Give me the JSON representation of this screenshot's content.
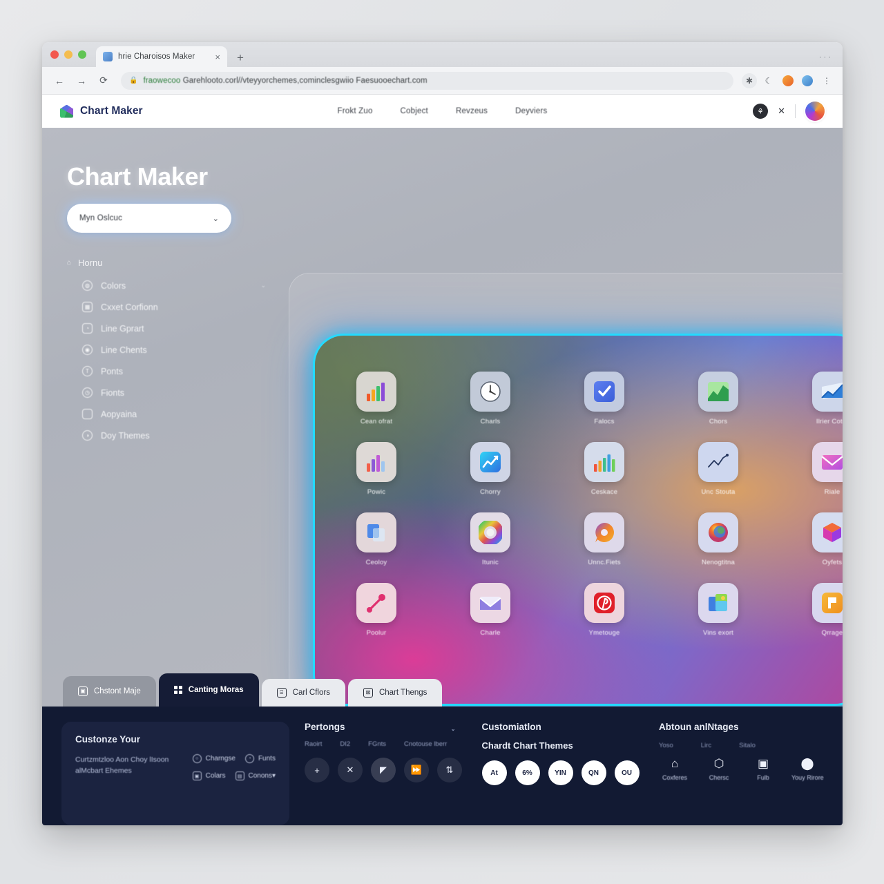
{
  "browser": {
    "tab_title": "hrie Charoisos Maker",
    "tab_close": "×",
    "new_tab": "+",
    "window_controls": "···",
    "back": "←",
    "forward": "→",
    "reload": "⟳",
    "lock_icon": "lock-icon",
    "url_secure_part": "fraowecoo",
    "url_rest": "Garehlooto.corl//vteyyorchemes,cominclesgwiio Faesuooechart.com",
    "star_icon": "★",
    "toolbar_icons": [
      "star-icon",
      "crescent-icon",
      "extension-orange-icon",
      "extension-blue-icon",
      "kebab-menu-icon"
    ]
  },
  "header": {
    "brand": "Chart Maker",
    "nav": [
      "Frokt Zuo",
      "Cobject",
      "Revzeus",
      "Deyviers"
    ],
    "dark_badge": "⚘",
    "action_icon": "✕",
    "avatar": "user-avatar"
  },
  "sidebar": {
    "title": "Chart Maker",
    "select_value": "Myn Oslcuc",
    "select_caret": "⌄",
    "menu_head": {
      "glyph": "⌂",
      "label": "Hornu"
    },
    "items": [
      {
        "label": "Colors",
        "icon": "palette-icon",
        "glyph": "◍",
        "shape": "round",
        "caret": "⌄"
      },
      {
        "label": "Cxxet Corfionn",
        "icon": "bar-chart-icon",
        "glyph": "▦",
        "shape": "square",
        "caret": ""
      },
      {
        "label": "Line Gprart",
        "icon": "line-chart-icon",
        "glyph": "◔",
        "shape": "square",
        "caret": ""
      },
      {
        "label": "Line Chents",
        "icon": "chart-icon",
        "glyph": "◉",
        "shape": "round",
        "caret": ""
      },
      {
        "label": "Ponts",
        "icon": "font-icon",
        "glyph": "T",
        "shape": "round",
        "caret": ""
      },
      {
        "label": "Fionts",
        "icon": "clock-icon",
        "glyph": "◷",
        "shape": "round",
        "caret": ""
      },
      {
        "label": "Aopyaina",
        "icon": "window-icon",
        "glyph": "",
        "shape": "plain",
        "caret": ""
      },
      {
        "label": "Doy Themes",
        "icon": "theme-icon",
        "glyph": "◑",
        "shape": "round",
        "caret": ""
      }
    ]
  },
  "showcase": {
    "tiles": [
      {
        "label": "Cean ofrat",
        "icon": "bar-chart-icon",
        "tile_bg": "#d8d6d0",
        "kind": "bars-rainbow"
      },
      {
        "label": "Charls",
        "icon": "clock-icon",
        "tile_bg": "#c2cad8",
        "kind": "clock"
      },
      {
        "label": "Falocs",
        "icon": "checkmark-icon",
        "tile_bg": "#c2cbe0",
        "kind": "check"
      },
      {
        "label": "Chors",
        "icon": "area-chart-icon",
        "tile_bg": "#c6cfe0",
        "kind": "area-green"
      },
      {
        "label": "Ilrier Cotot",
        "icon": "trend-chart-icon",
        "tile_bg": "#cdd6ea",
        "kind": "trend-blue"
      },
      {
        "label": "Powic",
        "icon": "bar-chart-icon",
        "tile_bg": "#ded9d6",
        "kind": "bars-pastel"
      },
      {
        "label": "Chorry",
        "icon": "line-chart-app-icon",
        "tile_bg": "#cfd5e6",
        "kind": "line-app"
      },
      {
        "label": "Ceskace",
        "icon": "bar-chart-icon",
        "tile_bg": "#d5dceb",
        "kind": "bars-multi"
      },
      {
        "label": "Unc Stouta",
        "icon": "zigzag-line-icon",
        "tile_bg": "#ced7ef",
        "kind": "zigzag"
      },
      {
        "label": "Riale",
        "icon": "mail-icon",
        "tile_bg": "#e6d7ea",
        "kind": "mail-pink"
      },
      {
        "label": "Ceoloy",
        "icon": "files-icon",
        "tile_bg": "#e3d7da",
        "kind": "files"
      },
      {
        "label": "Itunic",
        "icon": "color-wheel-icon",
        "tile_bg": "#e2dbe6",
        "kind": "colorwheel"
      },
      {
        "label": "Unnc.Fiets",
        "icon": "chat-bubble-icon",
        "tile_bg": "#ded9ea",
        "kind": "bubble-orange"
      },
      {
        "label": "Nenogtitna",
        "icon": "firefox-icon",
        "tile_bg": "#d6daef",
        "kind": "firefox"
      },
      {
        "label": "Oyfets",
        "icon": "cube-icon",
        "tile_bg": "#d5dcf0",
        "kind": "cube"
      },
      {
        "label": "Poolur",
        "icon": "pin-icon",
        "tile_bg": "#f0d5dd",
        "kind": "pin"
      },
      {
        "label": "Charle",
        "icon": "mail-icon",
        "tile_bg": "#ecd8e4",
        "kind": "mail-violet"
      },
      {
        "label": "Ymetouge",
        "icon": "pinterest-icon",
        "tile_bg": "#eed5dd",
        "kind": "pinterest"
      },
      {
        "label": "Vins exort",
        "icon": "photos-icon",
        "tile_bg": "#dcd8ee",
        "kind": "photos"
      },
      {
        "label": "Qrrage",
        "icon": "note-icon",
        "tile_bg": "#d8d8ef",
        "kind": "note-amber"
      }
    ]
  },
  "bottom_tabs": [
    {
      "label": "Chstont Maje",
      "icon": "image-icon",
      "state": "inactive-grey"
    },
    {
      "label": "Canting Moras",
      "icon": "grid-icon",
      "state": "active"
    },
    {
      "label": "Carl Cflors",
      "icon": "bag-icon",
      "state": "light"
    },
    {
      "label": "Chart Thengs",
      "icon": "chart-icon",
      "state": "light"
    }
  ],
  "footer": {
    "card": {
      "title": "Custonze Your",
      "text": "Curtzmtzloo  Aon Choy lIsoon alMcbart Ehemes",
      "links": [
        {
          "label": "Charngse",
          "icon": "circle-icon",
          "shape": "round",
          "glyph": "○"
        },
        {
          "label": "Funts",
          "icon": "font-icon",
          "shape": "round",
          "glyph": "◔"
        },
        {
          "label": "Colars",
          "icon": "image-icon",
          "shape": "square",
          "glyph": "▣"
        },
        {
          "label": "Conons▾",
          "icon": "card-icon",
          "shape": "square",
          "glyph": "▤"
        }
      ]
    },
    "middle": {
      "title": "Pertongs",
      "caret": "⌄",
      "sublabels": [
        "Raoirt",
        "DI2",
        "FGnts",
        "Cnotouse lberr"
      ],
      "circles": [
        {
          "label": "+",
          "icon": "plus-icon",
          "hi": false
        },
        {
          "label": "✕",
          "icon": "close-icon",
          "hi": false
        },
        {
          "label": "◤",
          "icon": "flag-icon",
          "hi": true
        },
        {
          "label": "⏩",
          "icon": "forward-icon",
          "hi": false
        },
        {
          "label": "⇅",
          "icon": "sort-icon",
          "hi": false
        }
      ]
    },
    "third": {
      "title": "Customiatlon",
      "subtitle": "Chardt Chart Themes",
      "circles": [
        "At",
        "6%",
        "YIN",
        "QN",
        "OU"
      ]
    },
    "last": {
      "title": "Abtoun anlNtages",
      "labels": [
        "Yoso",
        "Lirc",
        "Sitalo"
      ],
      "items": [
        {
          "caption": "Coxferes",
          "icon": "home-icon",
          "glyph": "⌂"
        },
        {
          "caption": "Chersc",
          "icon": "shield-icon",
          "glyph": "⬡"
        },
        {
          "caption": "Fulb",
          "icon": "badge-icon",
          "glyph": "▣"
        },
        {
          "caption": "Youy Rirore",
          "icon": "guard-icon",
          "glyph": "⬤"
        }
      ]
    }
  }
}
